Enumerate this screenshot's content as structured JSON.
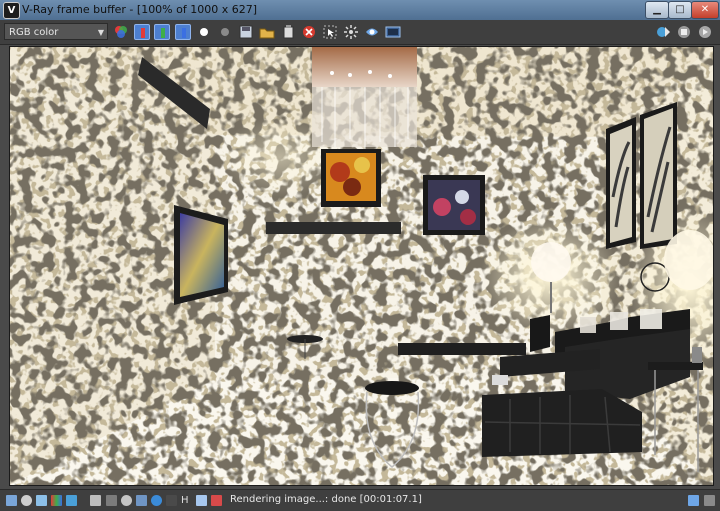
{
  "window": {
    "title": "V-Ray frame buffer - [100% of 1000 x 627]",
    "app_icon_glyph": "V"
  },
  "window_controls": {
    "minimize": "▁",
    "maximize": "□",
    "close": "✕"
  },
  "toolbar": {
    "channel": "RGB color",
    "icons": [
      "color-channels-icon",
      "red-channel-icon",
      "green-channel-icon",
      "blue-channel-icon",
      "white-dot-icon",
      "grey-dot-icon",
      "save-image-icon",
      "load-image-icon",
      "copy-icon",
      "clear-image-icon",
      "track-mouse-icon",
      "display-correction-icon",
      "histogram-icon"
    ],
    "right_icons": [
      "render-region-icon",
      "stop-render-icon",
      "render-icon"
    ]
  },
  "statusbar": {
    "text": "Rendering image...: done [00:01:07.1]",
    "icons": [
      "layers-icon",
      "lens-icon",
      "curve-icon",
      "stats-icon",
      "lut-icon",
      "history-icon",
      "settings-icon",
      "h-icon",
      "compare-icon",
      "link-icon"
    ],
    "right_icons": [
      "panel-toggle-icon",
      "menu-icon"
    ]
  },
  "colors": {
    "active_toggle": "#4d7fd0",
    "red": "#e23b3b",
    "green": "#3fae4a",
    "blue": "#3b6fe2"
  }
}
